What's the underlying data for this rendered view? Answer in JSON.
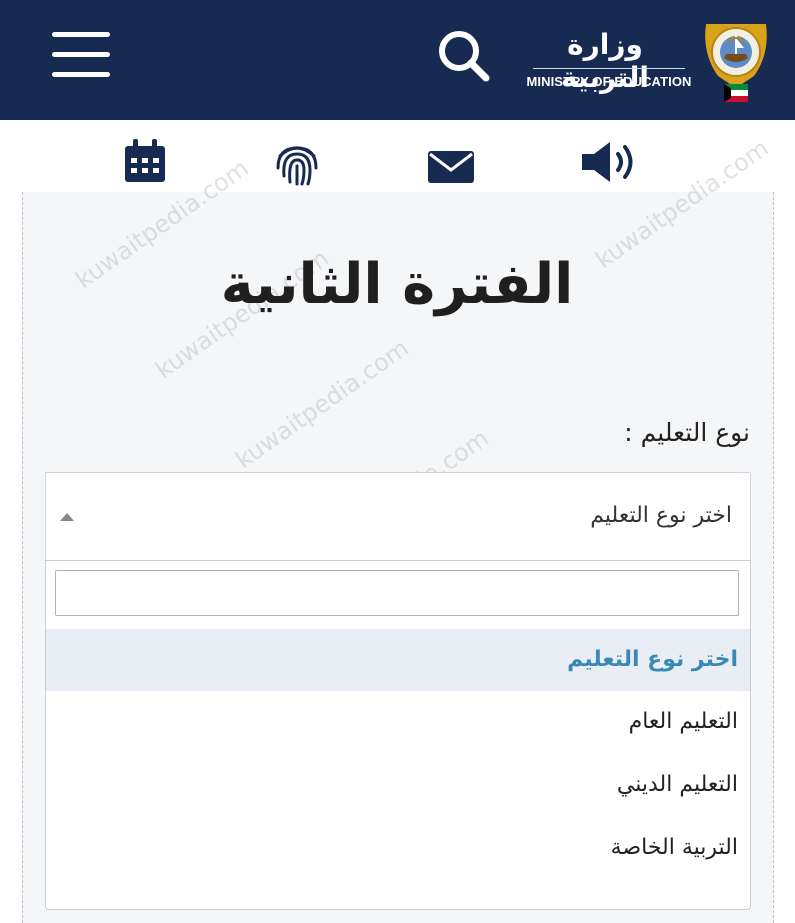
{
  "header": {
    "ministry_ar": "وزارة التربية",
    "ministry_en": "MINISTRY OF EDUCATION",
    "icons": {
      "menu": "hamburger-menu-icon",
      "search": "search-icon",
      "emblem": "kuwait-emblem-icon"
    },
    "background": "#172a52"
  },
  "quick_icons": [
    {
      "name": "calendar-icon"
    },
    {
      "name": "fingerprint-icon"
    },
    {
      "name": "envelope-icon"
    },
    {
      "name": "speaker-icon"
    }
  ],
  "page": {
    "title": "الفترة الثانية",
    "field_label": "نوع التعليم :",
    "select": {
      "value": "اختر نوع التعليم",
      "search_value": "",
      "options": [
        {
          "label": "اختر نوع التعليم",
          "selected": true
        },
        {
          "label": "التعليم العام",
          "selected": false
        },
        {
          "label": "التعليم الديني",
          "selected": false
        },
        {
          "label": "التربية الخاصة",
          "selected": false
        }
      ]
    }
  },
  "watermark": "kuwaitpedia.com",
  "colors": {
    "navy": "#172a52",
    "selected_text": "#3a89b5",
    "selected_bg": "#e9eef5"
  }
}
